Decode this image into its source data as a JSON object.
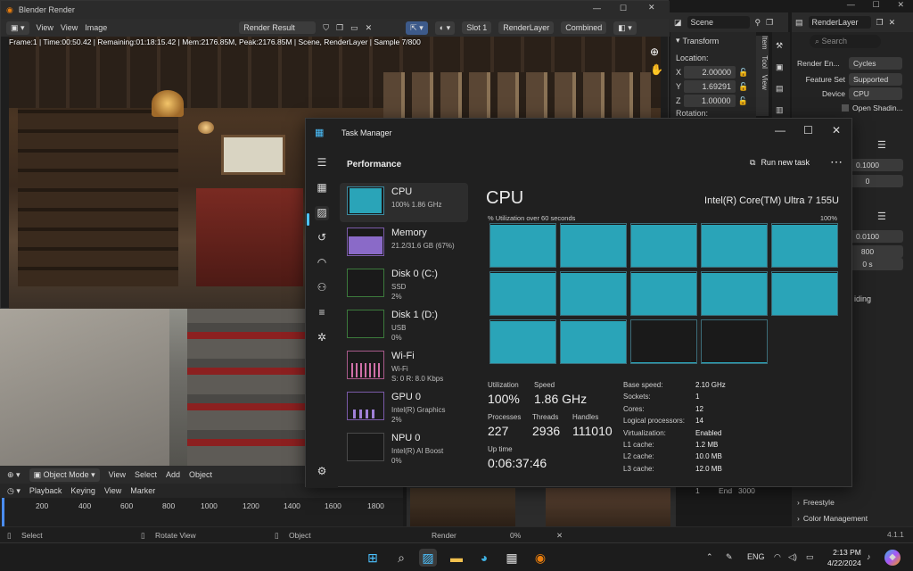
{
  "render_window": {
    "title": "Blender Render",
    "menu": [
      "View",
      "View",
      "Image"
    ],
    "image_name": "Render Result",
    "slot": "Slot 1",
    "layer": "RenderLayer",
    "pass": "Combined",
    "overlay_text": "Frame:1 | Time:00:50.42 | Remaining:01:18:15.42 | Mem:2176.85M, Peak:2176.85M | Scene, RenderLayer | Sample 7/800"
  },
  "viewport": {
    "mode": "Object Mode",
    "menu": [
      "View",
      "Select",
      "Add",
      "Object"
    ]
  },
  "timeline": {
    "menu": [
      "Playback",
      "Keying",
      "View",
      "Marker"
    ],
    "ticks": [
      "200",
      "400",
      "600",
      "800",
      "1000",
      "1200",
      "1400",
      "1600",
      "1800"
    ],
    "end_label": "End",
    "end_value": "3000",
    "start_value": "1"
  },
  "statusbar": {
    "select": "Select",
    "rotate": "Rotate View",
    "object": "Object",
    "version": "4.1.1"
  },
  "outliner": {
    "scene": "Scene",
    "view_layer": "RenderLayer",
    "search_placeholder": "Search"
  },
  "npanel": {
    "section": "Transform",
    "location_label": "Location:",
    "x_label": "X",
    "x": "2.00000",
    "y_label": "Y",
    "y": "1.69291",
    "z_label": "Z",
    "z": "1.00000",
    "rotation_label": "Rotation:",
    "tabs": [
      "Item",
      "Tool",
      "View"
    ]
  },
  "properties": {
    "render_engine_label": "Render En...",
    "render_engine": "Cycles",
    "feature_set_label": "Feature Set",
    "feature_set": "Supported",
    "device_label": "Device",
    "device": "CPU",
    "open_shading": "Open Shadin...",
    "val1": "0.1000",
    "val2": "0",
    "val3": "0.0100",
    "val4": "800",
    "val5": "0 s",
    "ding": "iding",
    "freestyle": "Freestyle",
    "color_management": "Color Management"
  },
  "thumbs": {
    "render_label": "Render",
    "pct": "0%"
  },
  "task_manager": {
    "title": "Task Manager",
    "page_title": "Performance",
    "run_new_task": "Run new task",
    "resources": [
      {
        "name": "CPU",
        "sub1": "100%  1.86 GHz",
        "sub2": ""
      },
      {
        "name": "Memory",
        "sub1": "21.2/31.6 GB (67%)",
        "sub2": ""
      },
      {
        "name": "Disk 0 (C:)",
        "sub1": "SSD",
        "sub2": "2%"
      },
      {
        "name": "Disk 1 (D:)",
        "sub1": "USB",
        "sub2": "0%"
      },
      {
        "name": "Wi-Fi",
        "sub1": "Wi-Fi",
        "sub2": "S: 0  R: 8.0 Kbps"
      },
      {
        "name": "GPU 0",
        "sub1": "Intel(R) Graphics",
        "sub2": "2%"
      },
      {
        "name": "NPU 0",
        "sub1": "Intel(R) AI Boost",
        "sub2": "0%"
      }
    ],
    "cpu_heading": "CPU",
    "cpu_model": "Intel(R) Core(TM) Ultra 7 155U",
    "util_label": "% Utilization over 60 seconds",
    "util_max": "100%",
    "core_fill": [
      0.98,
      0.98,
      0.98,
      0.98,
      0.98,
      0.98,
      0.98,
      0.98,
      0.98,
      0.98,
      0.98,
      0.98,
      0.02,
      0.02
    ],
    "stats": {
      "utilization_label": "Utilization",
      "utilization": "100%",
      "speed_label": "Speed",
      "speed": "1.86 GHz",
      "processes_label": "Processes",
      "processes": "227",
      "threads_label": "Threads",
      "threads": "2936",
      "handles_label": "Handles",
      "handles": "111010",
      "uptime_label": "Up time",
      "uptime": "0:06:37:46"
    },
    "details": [
      {
        "k": "Base speed:",
        "v": "2.10 GHz"
      },
      {
        "k": "Sockets:",
        "v": "1"
      },
      {
        "k": "Cores:",
        "v": "12"
      },
      {
        "k": "Logical processors:",
        "v": "14"
      },
      {
        "k": "Virtualization:",
        "v": "Enabled"
      },
      {
        "k": "L1 cache:",
        "v": "1.2 MB"
      },
      {
        "k": "L2 cache:",
        "v": "10.0 MB"
      },
      {
        "k": "L3 cache:",
        "v": "12.0 MB"
      }
    ]
  },
  "taskbar": {
    "lang": "ENG",
    "time": "2:13 PM",
    "date": "4/22/2024"
  }
}
